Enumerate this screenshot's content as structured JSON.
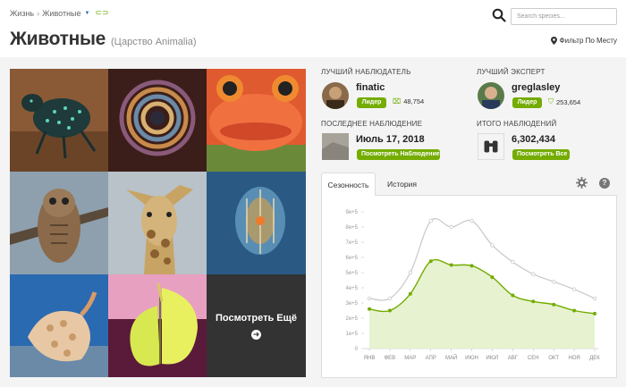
{
  "breadcrumb": {
    "root": "Жизнь",
    "separator": "›",
    "current": "Животные"
  },
  "header": {
    "title": "Животные",
    "subtitle": "(Царство Animalia)",
    "place_filter": "Фильтр По Месту"
  },
  "search": {
    "placeholder": "Search species..."
  },
  "photos": {
    "items": [
      "weevil",
      "feather-duster-worm",
      "red-frog",
      "owl",
      "giraffe",
      "comb-jelly",
      "sea-snail",
      "yellow-butterfly"
    ],
    "more_label": "Посмотреть Ещё"
  },
  "top_observer": {
    "heading": "ЛУЧШИЙ НАБЛЮДАТЕЛЬ",
    "name": "finatic",
    "badge": "Лидер",
    "count": "48,754"
  },
  "top_expert": {
    "heading": "ЛУЧШИЙ ЭКСПЕРТ",
    "name": "greglasley",
    "badge": "Лидер",
    "count": "253,654"
  },
  "last_observation": {
    "heading": "ПОСЛЕДНЕЕ НАБЛЮДЕНИЕ",
    "date": "Июль 17, 2018",
    "button": "Посмотреть Наблюдение"
  },
  "total_observations": {
    "heading": "ИТОГО НАБЛЮДЕНИЙ",
    "count": "6,302,434",
    "button": "Посмотреть Все"
  },
  "tabs": [
    "Сезонность",
    "История"
  ],
  "colors": {
    "accent": "#74ac00",
    "area_fill": "#e6f2d0",
    "gray_line": "#c8c8c8"
  },
  "chart_data": {
    "type": "line",
    "categories": [
      "ЯНВ",
      "ФЕВ",
      "МАР",
      "АПР",
      "МАЙ",
      "ИЮН",
      "ИЮЛ",
      "АВГ",
      "СЕН",
      "ОКТ",
      "НОЯ",
      "ДЕК"
    ],
    "yticks": [
      "0",
      "1e+5",
      "2e+5",
      "3e+5",
      "4e+5",
      "5e+5",
      "6e+5",
      "7e+5",
      "8e+5",
      "9e+5"
    ],
    "ylim": [
      0,
      900000
    ],
    "series": [
      {
        "style": "gray",
        "values": [
          330000,
          330000,
          500000,
          840000,
          800000,
          840000,
          680000,
          570000,
          490000,
          440000,
          390000,
          330000
        ]
      },
      {
        "style": "green-area",
        "values": [
          260000,
          250000,
          360000,
          575000,
          550000,
          545000,
          470000,
          350000,
          310000,
          290000,
          250000,
          230000
        ]
      }
    ]
  }
}
